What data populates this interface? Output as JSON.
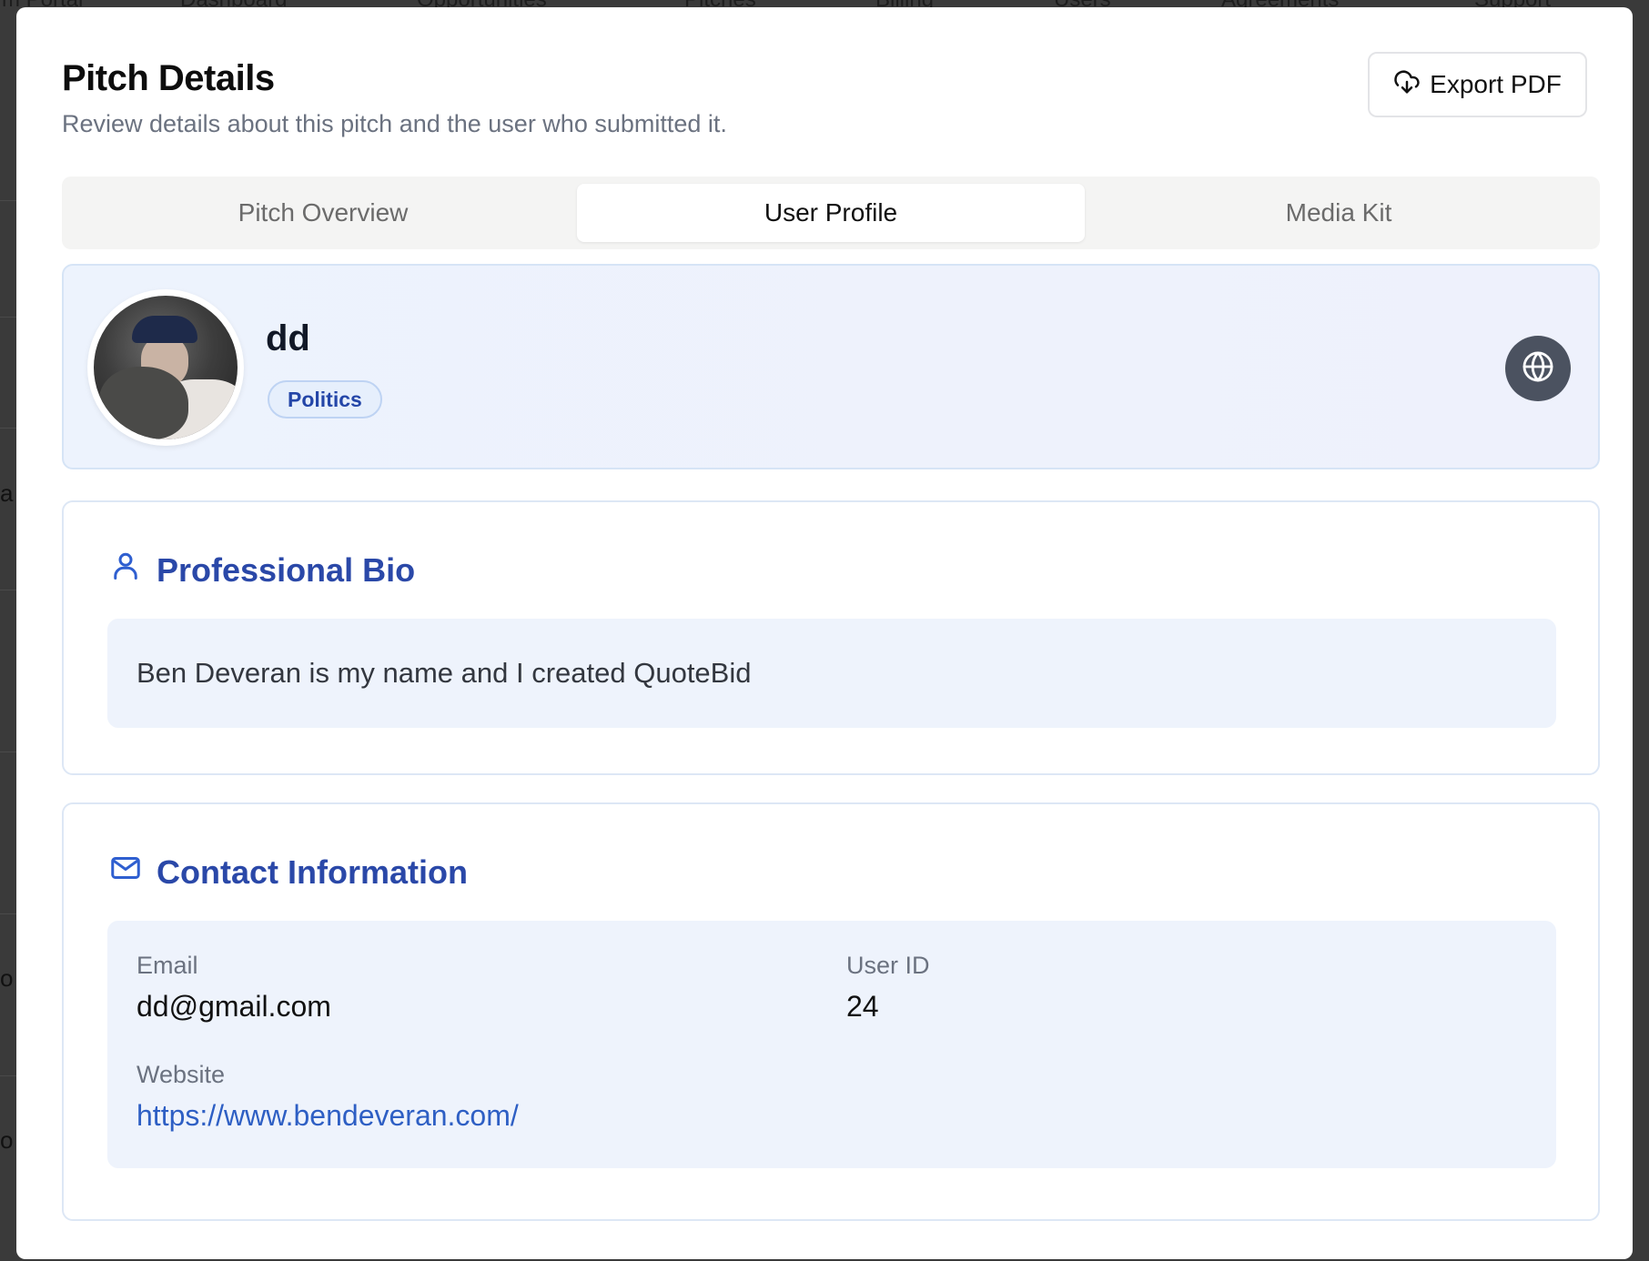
{
  "background": {
    "nav_items": [
      "rm Portal",
      "Dashboard",
      "Opportunities",
      "Pitches",
      "Billing",
      "Users",
      "Agreements",
      "Support"
    ],
    "edge_letters": [
      "a",
      "o",
      "o"
    ]
  },
  "modal": {
    "title": "Pitch Details",
    "subtitle": "Review details about this pitch and the user who submitted it.",
    "export_label": "Export PDF"
  },
  "tabs": [
    {
      "label": "Pitch Overview",
      "active": false
    },
    {
      "label": "User Profile",
      "active": true
    },
    {
      "label": "Media Kit",
      "active": false
    }
  ],
  "profile": {
    "name": "dd",
    "tag": "Politics"
  },
  "bio": {
    "heading": "Professional Bio",
    "text": "Ben Deveran is my name and I created QuoteBid"
  },
  "contact": {
    "heading": "Contact Information",
    "email_label": "Email",
    "email": "dd@gmail.com",
    "userid_label": "User ID",
    "userid": "24",
    "website_label": "Website",
    "website": "https://www.bendeveran.com/"
  },
  "colors": {
    "accent": "#2a48a8",
    "link": "#2e5fc4",
    "tag_text": "#2446a8"
  },
  "icons": {
    "export": "cloud-download-icon",
    "globe": "globe-icon",
    "bio": "user-icon",
    "contact": "mail-icon"
  }
}
